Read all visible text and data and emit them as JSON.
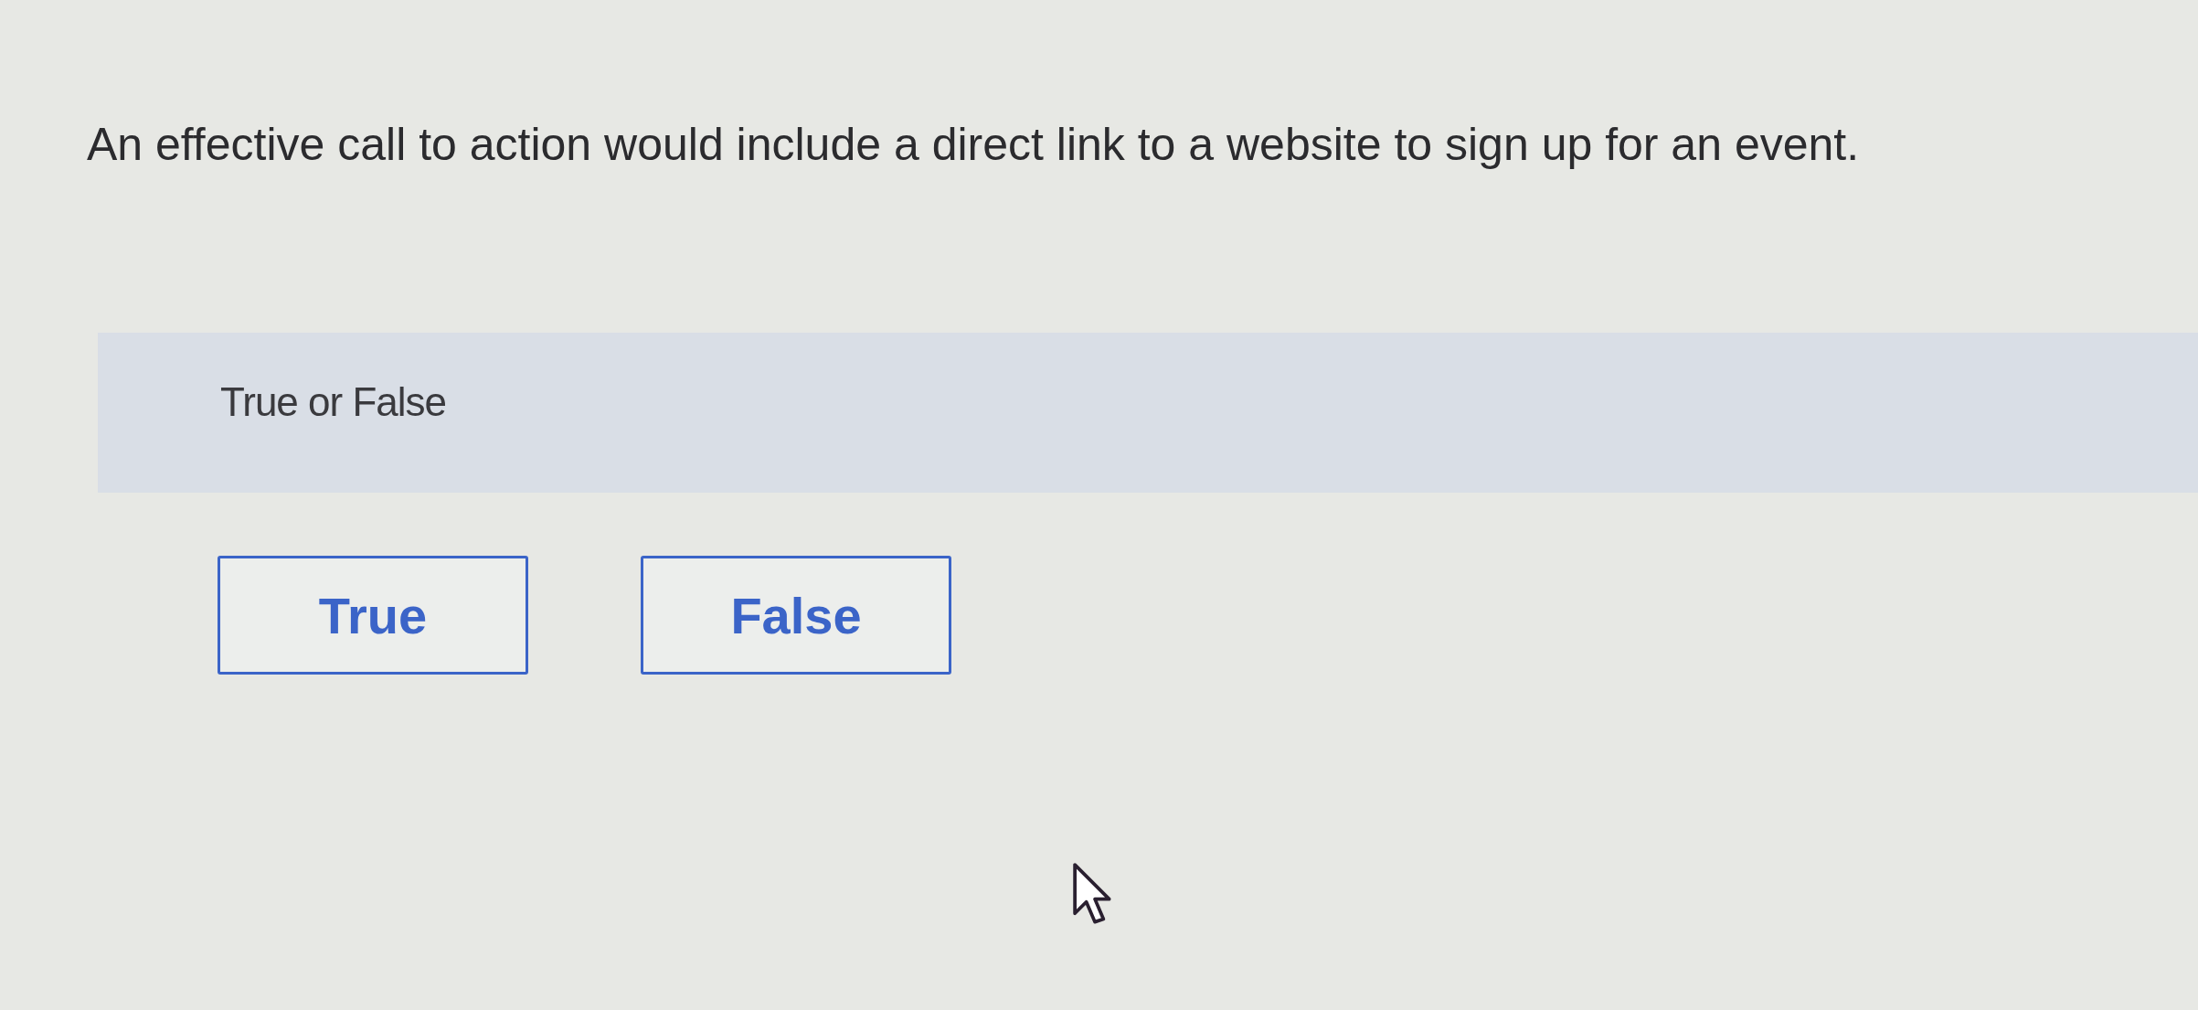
{
  "question": {
    "text": "An effective call to action would include a direct link to a website to sign up for an event."
  },
  "prompt": {
    "label": "True or False"
  },
  "options": [
    {
      "label": "True",
      "selected": false
    },
    {
      "label": "False",
      "selected": false
    }
  ]
}
